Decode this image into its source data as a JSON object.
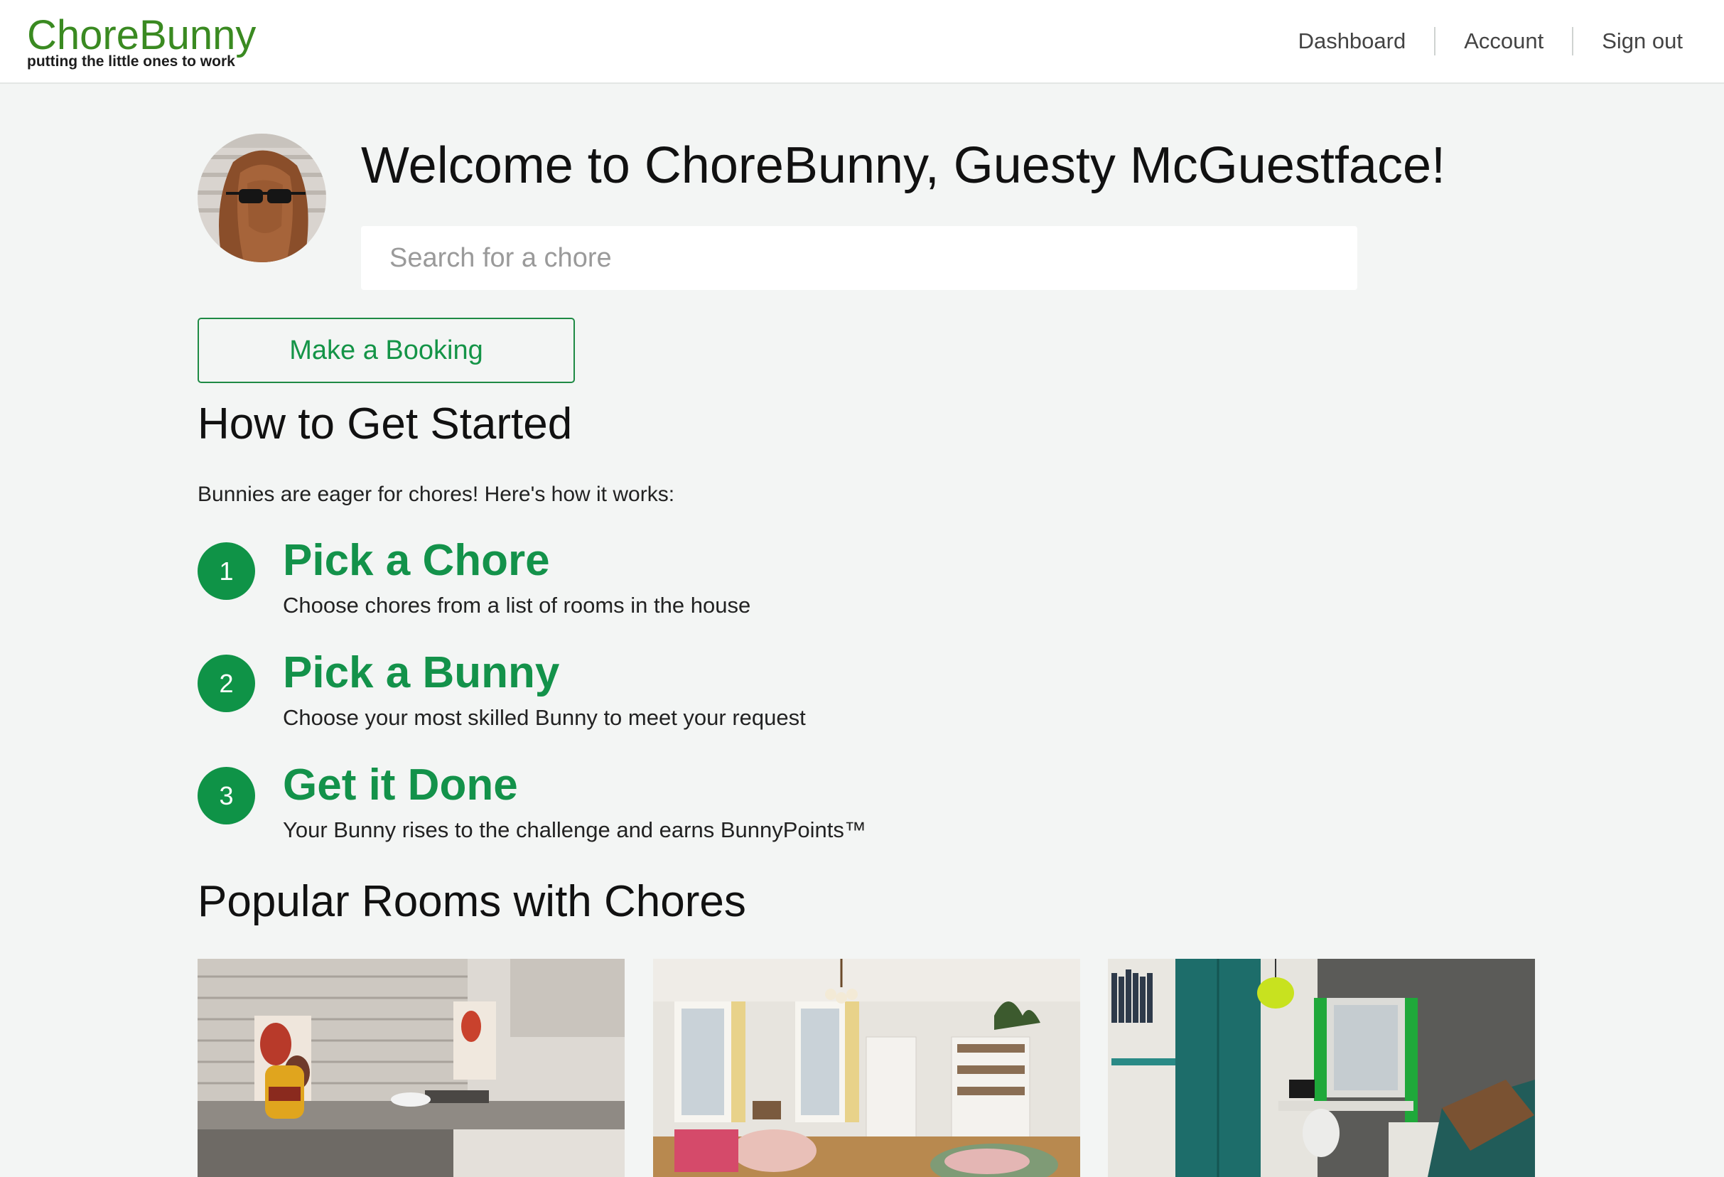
{
  "brand": {
    "name": "ChoreBunny",
    "tagline": "putting the little ones to work",
    "color": "#3a8a21"
  },
  "nav": {
    "dashboard": "Dashboard",
    "account": "Account",
    "signout": "Sign out"
  },
  "header": {
    "welcome": "Welcome to ChoreBunny, Guesty McGuestface!",
    "search_placeholder": "Search for a chore"
  },
  "booking_button": "Make a Booking",
  "getting_started": {
    "title": "How to Get Started",
    "intro": "Bunnies are eager for chores! Here's how it works:",
    "steps": [
      {
        "number": "1",
        "title": "Pick a Chore",
        "description": "Choose chores from a list of rooms in the house"
      },
      {
        "number": "2",
        "title": "Pick a Bunny",
        "description": "Choose your most skilled Bunny to meet your request"
      },
      {
        "number": "3",
        "title": "Get it Done",
        "description": "Your Bunny rises to the challenge and earns BunnyPoints™"
      }
    ]
  },
  "popular_rooms": {
    "title": "Popular Rooms with Chores",
    "rooms": [
      "kitchen-photo",
      "living-room-photo",
      "bedroom-photo"
    ]
  },
  "colors": {
    "accent_green": "#13924a",
    "background": "#f3f5f4"
  }
}
